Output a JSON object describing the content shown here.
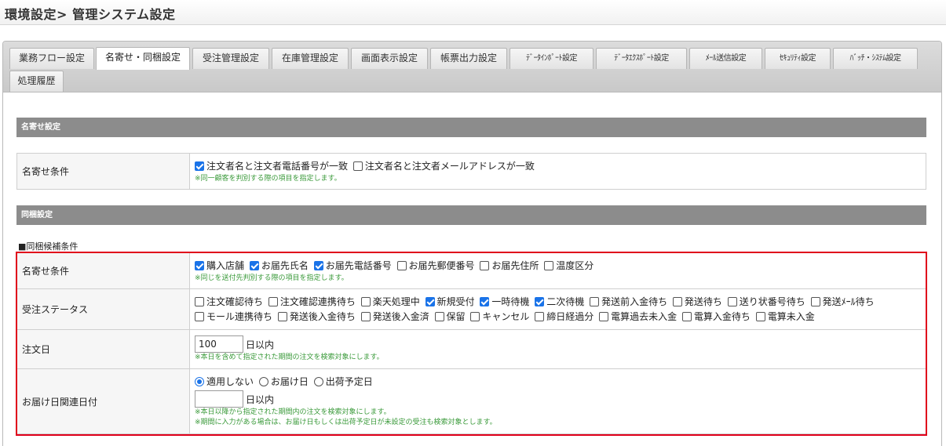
{
  "page": {
    "title": "環境設定> 管理システム設定"
  },
  "tabs": [
    {
      "label": "業務フロー設定",
      "active": false
    },
    {
      "label": "名寄せ・同梱設定",
      "active": true
    },
    {
      "label": "受注管理設定",
      "active": false
    },
    {
      "label": "在庫管理設定",
      "active": false
    },
    {
      "label": "画面表示設定",
      "active": false
    },
    {
      "label": "帳票出力設定",
      "active": false
    },
    {
      "label": "ﾃﾞｰﾀｲﾝﾎﾟｰﾄ設定",
      "active": false
    },
    {
      "label": "ﾃﾞｰﾀｴｸｽﾎﾟｰﾄ設定",
      "active": false
    },
    {
      "label": "ﾒｰﾙ送信設定",
      "active": false
    },
    {
      "label": "ｾｷｭﾘﾃｨ設定",
      "active": false
    },
    {
      "label": "ﾊﾞｯﾁ・ｼｽﾃﾑ設定",
      "active": false
    },
    {
      "label": "処理履歴",
      "active": false
    }
  ],
  "nayose": {
    "section_title": "名寄せ設定",
    "condition": {
      "label": "名寄せ条件",
      "options": [
        {
          "label": "注文者名と注文者電話番号が一致",
          "checked": true
        },
        {
          "label": "注文者名と注文者メールアドレスが一致",
          "checked": false
        }
      ],
      "note": "※同一顧客を判別する際の項目を指定します。"
    }
  },
  "doukon": {
    "section_title": "同梱設定",
    "subsection_title": "■同梱候補条件",
    "condition": {
      "label": "名寄せ条件",
      "options": [
        {
          "label": "購入店舗",
          "checked": true
        },
        {
          "label": "お届先氏名",
          "checked": true
        },
        {
          "label": "お届先電話番号",
          "checked": true
        },
        {
          "label": "お届先郵便番号",
          "checked": false
        },
        {
          "label": "お届先住所",
          "checked": false
        },
        {
          "label": "温度区分",
          "checked": false
        }
      ],
      "note": "※同じを送付先判別する際の項目を指定します。"
    },
    "status": {
      "label": "受注ステータス",
      "options": [
        {
          "label": "注文確認待ち",
          "checked": false
        },
        {
          "label": "注文確認連携待ち",
          "checked": false
        },
        {
          "label": "楽天処理中",
          "checked": false
        },
        {
          "label": "新規受付",
          "checked": true
        },
        {
          "label": "一時待機",
          "checked": true
        },
        {
          "label": "二次待機",
          "checked": true
        },
        {
          "label": "発送前入金待ち",
          "checked": false
        },
        {
          "label": "発送待ち",
          "checked": false
        },
        {
          "label": "送り状番号待ち",
          "checked": false
        },
        {
          "label": "発送ﾒｰﾙ待ち",
          "checked": false
        },
        {
          "label": "モール連携待ち",
          "checked": false
        },
        {
          "label": "発送後入金待ち",
          "checked": false
        },
        {
          "label": "発送後入金済",
          "checked": false
        },
        {
          "label": "保留",
          "checked": false
        },
        {
          "label": "キャンセル",
          "checked": false
        },
        {
          "label": "締日経過分",
          "checked": false
        },
        {
          "label": "電算過去未入金",
          "checked": false
        },
        {
          "label": "電算入金待ち",
          "checked": false
        },
        {
          "label": "電算未入金",
          "checked": false
        }
      ]
    },
    "order_date": {
      "label": "注文日",
      "value": "100",
      "unit": "日以内",
      "note": "※本日を含めて指定された期間の注文を検索対象にします。"
    },
    "delivery_date": {
      "label": "お届け日関連日付",
      "options": [
        {
          "label": "適用しない",
          "selected": true
        },
        {
          "label": "お届け日",
          "selected": false
        },
        {
          "label": "出荷予定日",
          "selected": false
        }
      ],
      "value": "",
      "unit": "日以内",
      "note1": "※本日以降から指定された期間内の注文を検索対象にします。",
      "note2": "※期間に入力がある場合は、お届け日もしくは出荷予定日が未設定の受注も検索対象とします。"
    }
  },
  "colors": {
    "highlight": "#e0001b",
    "section_bar": "#8c8c8c",
    "note": "#3a9a3a",
    "check": "#1a73e8"
  }
}
